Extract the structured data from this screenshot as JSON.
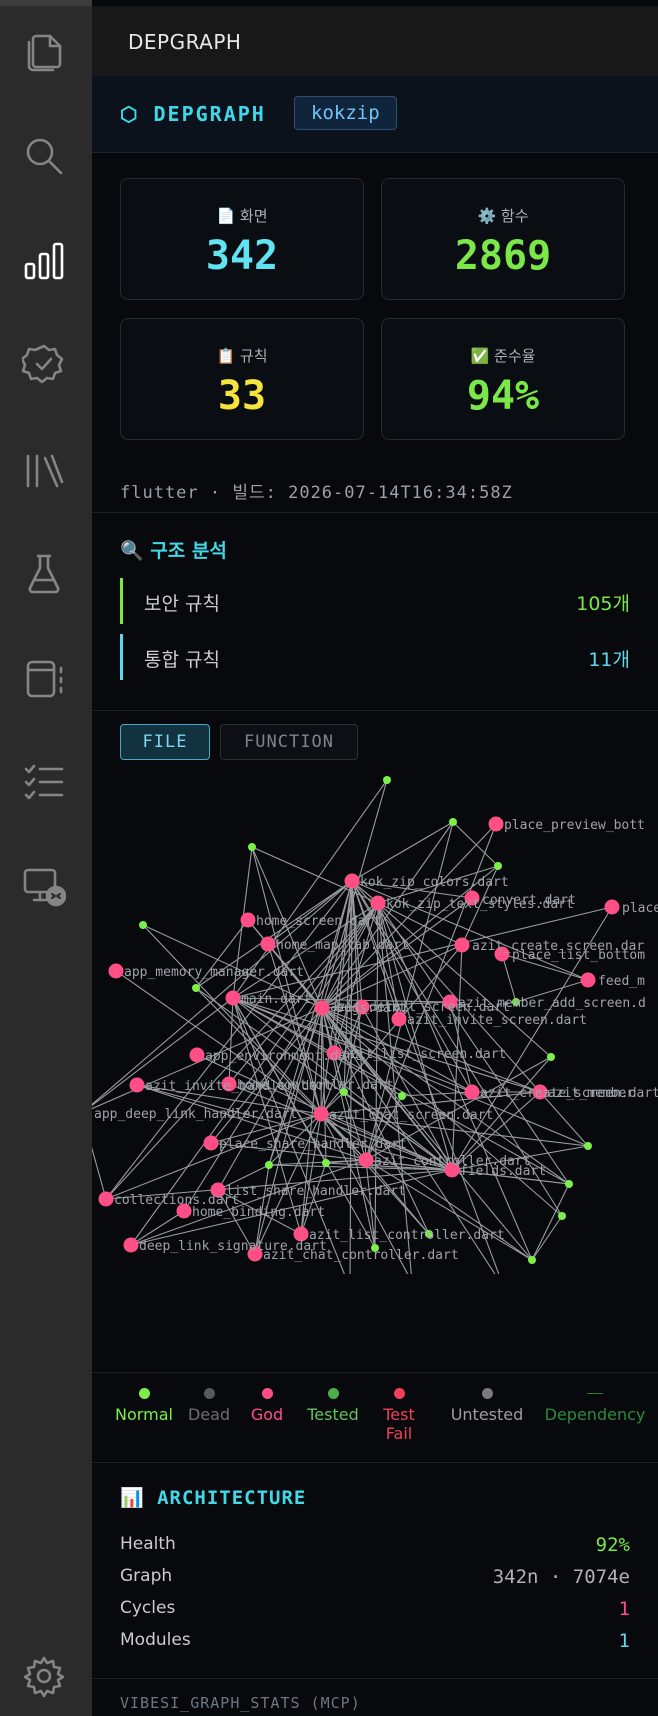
{
  "activity_bar": {
    "items": [
      {
        "icon": "explorer-icon"
      },
      {
        "icon": "search-icon"
      },
      {
        "icon": "chart-bars-icon",
        "active": true
      },
      {
        "icon": "verified-badge-icon"
      },
      {
        "icon": "library-icon"
      },
      {
        "icon": "flask-icon"
      },
      {
        "icon": "notebook-icon"
      },
      {
        "icon": "checklist-icon"
      },
      {
        "icon": "remote-explorer-icon"
      }
    ],
    "bottom": {
      "icon": "gear-icon"
    }
  },
  "panel": {
    "title": "DEPGRAPH"
  },
  "brand": {
    "name": "⬡ DEPGRAPH",
    "project": "kokzip"
  },
  "stats": {
    "screens": {
      "icon": "📄",
      "label": "화면",
      "value": "342",
      "color": "#62e3f2"
    },
    "functions": {
      "icon": "⚙️",
      "label": "함수",
      "value": "2869",
      "color": "#7be84a"
    },
    "rules": {
      "icon": "📋",
      "label": "규칙",
      "value": "33",
      "color": "#f5e43d"
    },
    "compliance": {
      "icon": "✅",
      "label": "준수율",
      "value": "94%",
      "color": "#7be84a"
    }
  },
  "build": "flutter · 빌드: 2026-07-14T16:34:58Z",
  "analysis": {
    "title": "🔍 구조 분석",
    "rules": [
      {
        "label": "보안 규칙",
        "count": "105개",
        "color": "#7be84a"
      },
      {
        "label": "통합 규칙",
        "count": "11개",
        "color": "#5fd8ee"
      }
    ]
  },
  "tabs": {
    "file": "FILE",
    "function": "FUNCTION"
  },
  "graph": {
    "node_labels": [
      "place_preview_bott",
      "kok_zip_colors.dart",
      "kok_zip_text_styles.dart",
      "convert.dart",
      "place_",
      "home_screen.dart",
      "home_map_tab.dart",
      "azit_create_screen.dar",
      "place_list_bottom",
      "app_memory_manager.dart",
      "feed_m",
      "main.dart",
      "azit_member_add_screen.d",
      "bugs.dart",
      "azit_detail_screen.dart",
      "azit_invite_screen.dart",
      "app_environment.dart",
      "azit_list_screen.dart",
      "home_controller.dart",
      "azit_invite_handler.dart",
      "azit_create_screen.dart",
      "azit_member",
      "app_deep_link_handler.dart",
      "azit_chat_screen.dart",
      "place_share_handler.dart",
      "azit_controller.dart",
      "fields.dart",
      "list_share_handler.dart",
      "collections.dart",
      "home_binding.dart",
      "azit_list_controller.dart",
      "deep_link_signature.dart",
      "azit_chat_controller.dart"
    ]
  },
  "legend": [
    {
      "label": "Normal",
      "color": "#7cf04a"
    },
    {
      "label": "Dead",
      "color": "#555a60"
    },
    {
      "label": "God",
      "color": "#ff4f86"
    },
    {
      "label": "Tested",
      "color": "#4cb04a"
    },
    {
      "label": "Test Fail",
      "color": "#f24058"
    },
    {
      "label": "Untested",
      "color": "#787c82"
    },
    {
      "label": "Dependency",
      "color": "#2e7a3a"
    }
  ],
  "architecture": {
    "title": "📊 ARCHITECTURE",
    "rows": [
      {
        "label": "Health",
        "value": "92%",
        "color": "#7be84a"
      },
      {
        "label": "Graph",
        "value": "342n · 7074e",
        "color": "#aeb3ba"
      },
      {
        "label": "Cycles",
        "value": "1",
        "color": "#ff4f86"
      },
      {
        "label": "Modules",
        "value": "1",
        "color": "#5fd8ee"
      }
    ]
  },
  "mcp": {
    "title": "VIBESI_GRAPH_STATS (MCP)"
  }
}
